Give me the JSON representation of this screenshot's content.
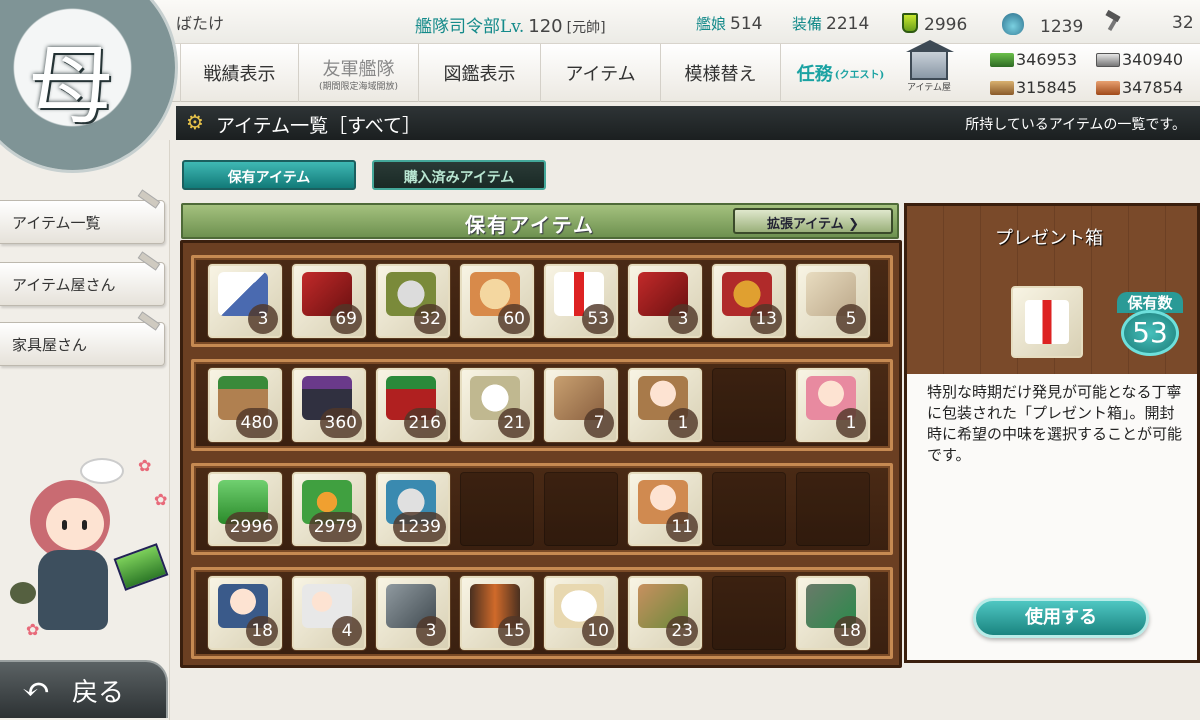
{
  "topbar": {
    "admiral_name": "ばたけ",
    "hq_label": "艦隊司令部Lv.",
    "hq_level": "120",
    "rank": "[元帥]",
    "ships_label": "艦娘",
    "ships_count": "514",
    "equip_label": "装備",
    "equip_count": "2214",
    "buckets": "2996",
    "devmats": "1239",
    "screws": "32"
  },
  "emblem": {
    "kanji": "母"
  },
  "nav": {
    "tabs": [
      {
        "label": "戦績表示",
        "sub": ""
      },
      {
        "label": "友軍艦隊",
        "sub": "(期間限定海域開放)"
      },
      {
        "label": "図鑑表示",
        "sub": ""
      },
      {
        "label": "アイテム",
        "sub": ""
      },
      {
        "label": "模様替え",
        "sub": ""
      },
      {
        "label": "任務",
        "sub": "(クエスト)"
      }
    ],
    "shop_caption": "アイテム屋"
  },
  "resources": {
    "fuel": "346953",
    "steel": "340940",
    "ammo": "315845",
    "bauxite": "347854"
  },
  "titlebar": {
    "title": "アイテム一覧［すべて］",
    "hint": "所持しているアイテムの一覧です。"
  },
  "sidebar": {
    "items": [
      {
        "label": "アイテム一覧"
      },
      {
        "label": "アイテム屋さん"
      },
      {
        "label": "家具屋さん"
      }
    ],
    "back_label": "戻る"
  },
  "tabs": {
    "owned": "保有アイテム",
    "purchased": "購入済みアイテム"
  },
  "list": {
    "header": "保有アイテム",
    "expand_label": "拡張アイテム ❯",
    "rows": [
      [
        {
          "art": "letter-icon",
          "count": "3"
        },
        {
          "art": "red-box-icon",
          "count": "69"
        },
        {
          "art": "screw-icon",
          "count": "32"
        },
        {
          "art": "food-icon",
          "count": "60"
        },
        {
          "art": "gift-box-icon",
          "count": "53"
        },
        {
          "art": "red-box-icon",
          "count": "3"
        },
        {
          "art": "medal-icon",
          "count": "13"
        },
        {
          "art": "map-icon",
          "count": "5"
        }
      ],
      [
        {
          "art": "crate-icon",
          "count": "480"
        },
        {
          "art": "crate-icon",
          "count": "360"
        },
        {
          "art": "crate-icon",
          "count": "216"
        },
        {
          "art": "cup-icon",
          "count": "21"
        },
        {
          "art": "plank-icon",
          "count": "7"
        },
        {
          "art": "fairy-icon",
          "count": "1"
        },
        null,
        {
          "art": "fairy-icon",
          "count": "1"
        }
      ],
      [
        {
          "art": "bucket-icon",
          "count": "2996"
        },
        {
          "art": "flame-icon",
          "count": "2979"
        },
        {
          "art": "devmat-icon",
          "count": "1239"
        },
        null,
        null,
        {
          "art": "fairy-icon",
          "count": "11"
        },
        null,
        null
      ],
      [
        {
          "art": "pilot-fairy-icon",
          "count": "18"
        },
        {
          "art": "fairies-icon",
          "count": "4"
        },
        {
          "art": "gear-icon",
          "count": "3"
        },
        {
          "art": "drum-icon",
          "count": "15"
        },
        {
          "art": "mochi-icon",
          "count": "10"
        },
        {
          "art": "box-icon",
          "count": "23"
        },
        null,
        {
          "art": "tools-icon",
          "count": "18"
        }
      ]
    ]
  },
  "detail": {
    "name": "プレゼント箱",
    "owned_label": "保有数",
    "owned_count": "53",
    "description": "特別な時期だけ発見が可能となる丁寧に包装された「プレゼント箱」。開封時に希望の中味を選択することが可能です。",
    "use_label": "使用する"
  }
}
